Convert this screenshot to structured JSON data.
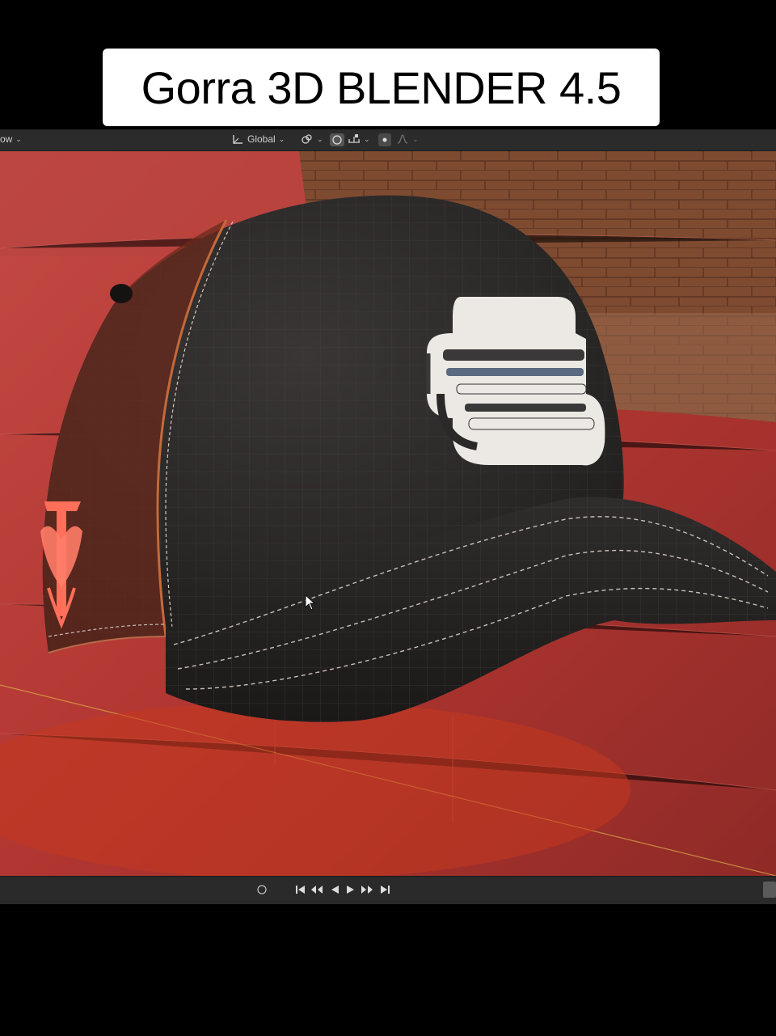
{
  "caption": {
    "title": "Gorra 3D BLENDER 4.5"
  },
  "header": {
    "shading_label": "ow",
    "transform_orientation": "Global",
    "icons": [
      "transform-axes-icon",
      "snap-link-icon",
      "proportional-edit-icon",
      "snap-increment-icon",
      "proportional-falloff-icon"
    ]
  },
  "viewport": {
    "object": "baseball-cap-mesh",
    "colors": {
      "floor": "#b83a34",
      "wall": "#8a4a2e",
      "cap": "#2e2b2b",
      "embroidery": "#e8e6e2",
      "side_logo": "#ff6f5a"
    }
  },
  "timeline": {
    "buttons": [
      "jump-start-icon",
      "previous-keyframe-icon",
      "play-reverse-icon",
      "play-icon",
      "next-keyframe-icon",
      "jump-end-icon"
    ]
  }
}
